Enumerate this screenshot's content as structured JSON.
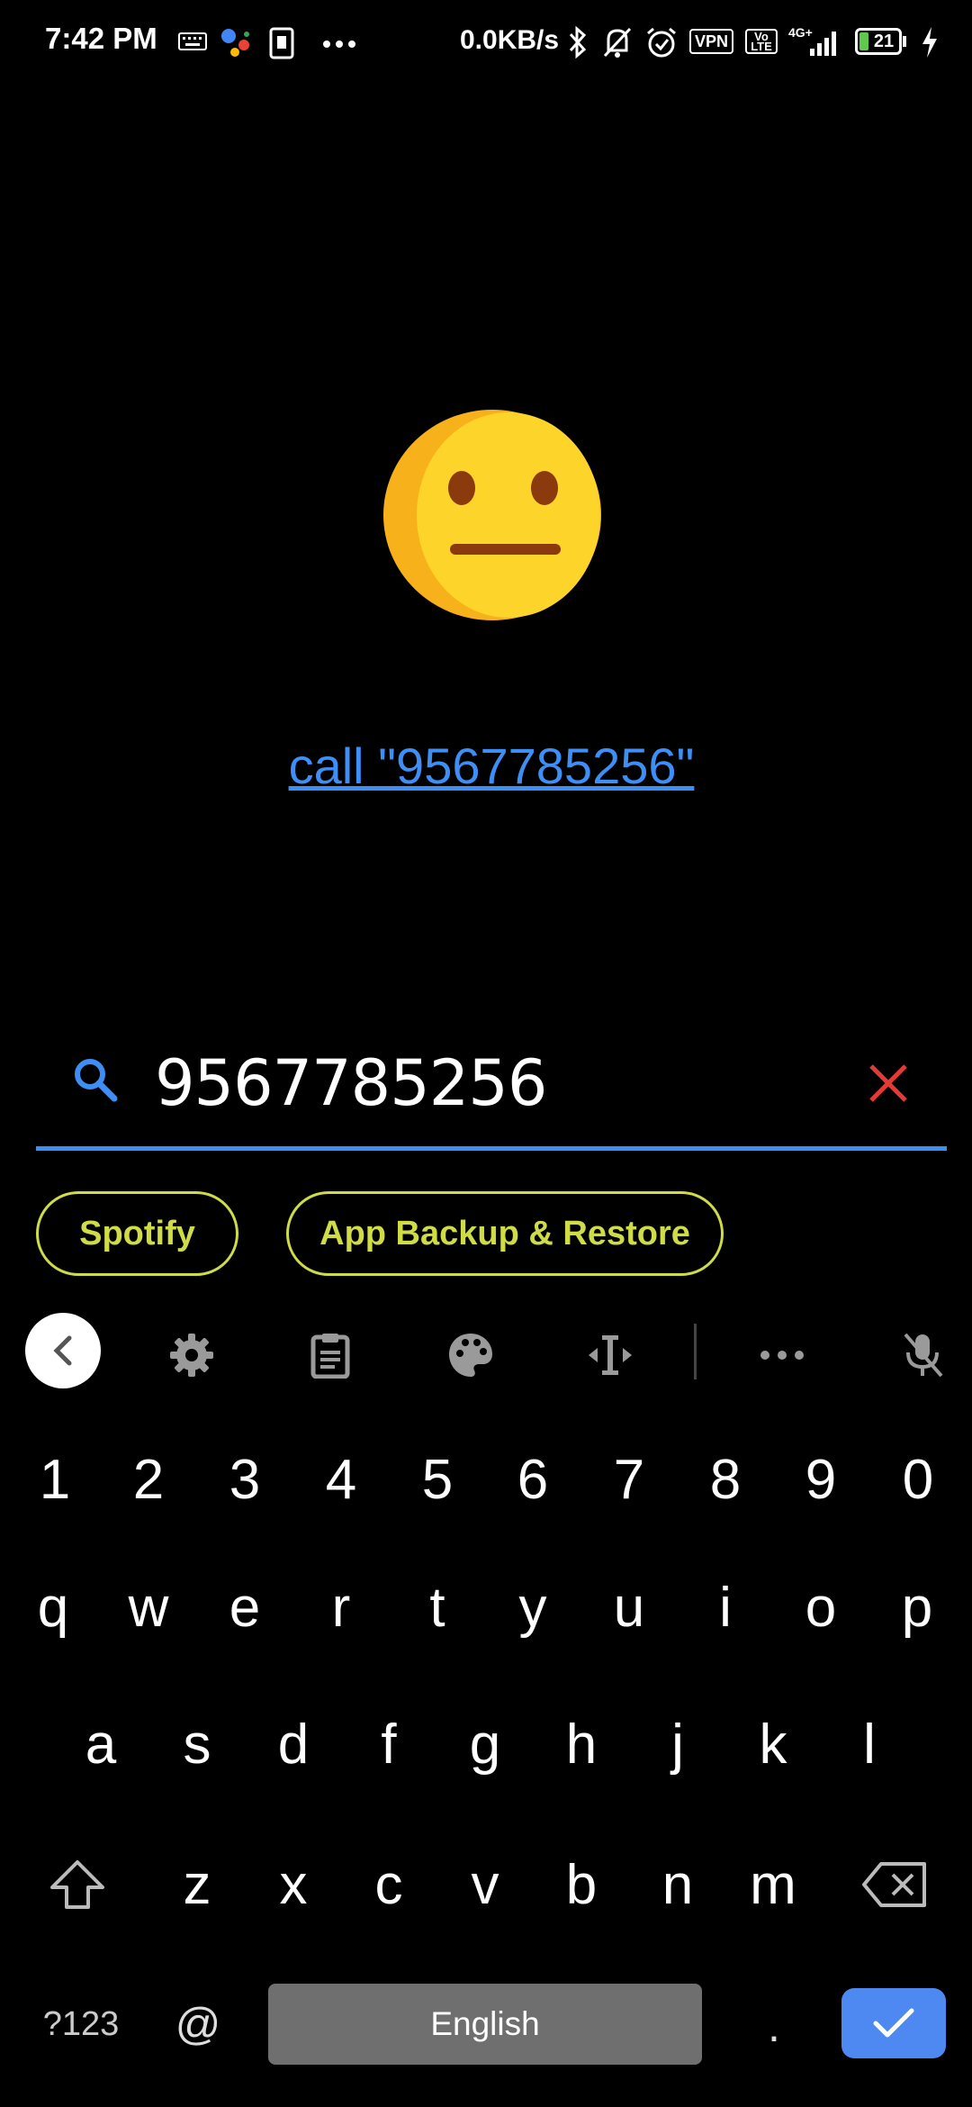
{
  "status_bar": {
    "time": "7:42 PM",
    "network_speed": "0.0KB/s",
    "vpn_label": "VPN",
    "volte_label": "Vo LTE",
    "network_type": "4G+",
    "battery_level": "21",
    "icons": [
      "keyboard-icon",
      "google-assistant-icon",
      "screenshot-icon",
      "more-dots-icon",
      "bluetooth-icon",
      "mute-bell-icon",
      "alarm-icon",
      "vpn-icon",
      "volte-icon",
      "signal-icon",
      "battery-icon",
      "charging-icon"
    ]
  },
  "result": {
    "emoji": "neutral-face",
    "call_link_text": "call \"9567785256\""
  },
  "search": {
    "value": "9567785256",
    "accent_color": "#3d8ff5",
    "clear_color": "#e53935"
  },
  "suggestions": [
    {
      "label": "Spotify"
    },
    {
      "label": "App Backup & Restore"
    }
  ],
  "suggestion_color": "#cfdc45",
  "keyboard": {
    "toolbar_icons": [
      "back-icon",
      "settings-icon",
      "clipboard-icon",
      "palette-icon",
      "cursor-move-icon",
      "more-icon",
      "mic-off-icon"
    ],
    "number_row": [
      "1",
      "2",
      "3",
      "4",
      "5",
      "6",
      "7",
      "8",
      "9",
      "0"
    ],
    "row1": [
      "q",
      "w",
      "e",
      "r",
      "t",
      "y",
      "u",
      "i",
      "o",
      "p"
    ],
    "row2": [
      "a",
      "s",
      "d",
      "f",
      "g",
      "h",
      "j",
      "k",
      "l"
    ],
    "row3": [
      "z",
      "x",
      "c",
      "v",
      "b",
      "n",
      "m"
    ],
    "symbols_key": "?123",
    "at_key": "@",
    "space_label": "English",
    "period_key": ".",
    "enter_color": "#4d89f0"
  }
}
